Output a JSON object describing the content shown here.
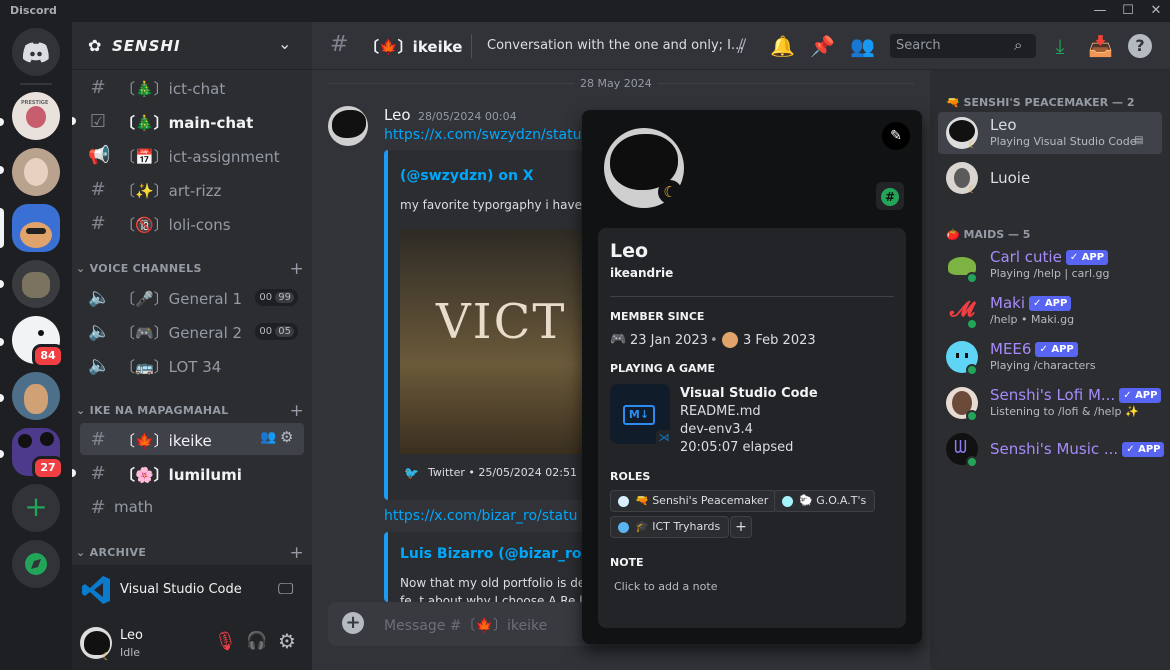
{
  "app": {
    "title": "Discord"
  },
  "server": {
    "name": "SENSHI"
  },
  "rail": {
    "badges": [
      "84",
      "27"
    ]
  },
  "channels": [
    {
      "name": "〔🎄〕ict-chat",
      "state": "normal"
    },
    {
      "name": "〔🎄〕main-chat",
      "state": "unread"
    },
    {
      "name": "〔📅〕ict-assignment",
      "state": "normal"
    },
    {
      "name": "〔✨〕art-rizz",
      "state": "normal"
    },
    {
      "name": "〔🔞〕loli-cons",
      "state": "normal"
    }
  ],
  "voice_category": "VOICE CHANNELS",
  "voice": [
    {
      "name": "〔🎤〕General 1",
      "a": "00",
      "b": "99"
    },
    {
      "name": "〔🎮〕General 2",
      "a": "00",
      "b": "05"
    },
    {
      "name": "〔🚌〕LOT 34"
    }
  ],
  "ike_category": "IKE NA MAPAGMAHAL",
  "ike_channels": [
    {
      "name": "〔🍁〕ikeike",
      "state": "active"
    },
    {
      "name": "〔🌸〕lumilumi",
      "state": "unread"
    },
    {
      "name": "math",
      "state": "normal"
    }
  ],
  "archive_category": "ARCHIVE",
  "activity": {
    "app": "Visual Studio Code"
  },
  "user": {
    "name": "Leo",
    "status": "Idle"
  },
  "chat": {
    "channel": "〔🍁〕ikeike",
    "topic": "Conversation with the one and only; I...",
    "date_divider": "28 May 2024",
    "search_placeholder": "Search",
    "composer_placeholder": "Message #〔🍁〕ikeike"
  },
  "message": {
    "author": "Leo",
    "timestamp": "28/05/2024 00:04",
    "link1": "https://x.com/swzydzn/statu",
    "embed1": {
      "author": "(@swzydzn) on X",
      "text": "my favorite typorgaphy i have c",
      "image_text": "VICT",
      "footer": "Twitter • 25/05/2024 02:51"
    },
    "link2": "https://x.com/bizar_ro/statu",
    "embed2": {
      "author": "Luis Bizarro (@bizar_ro) o",
      "text1": "Now that my old portfolio is de",
      "text2": "fe..t about why I choose A Re.l."
    }
  },
  "members": {
    "group1": "SENSHI'S PEACEMAKER — 2",
    "group2": "MAIDS — 5",
    "app_badge": "APP",
    "list1": [
      {
        "name": "Leo",
        "status": "Playing Visual Studio Code",
        "color": "#f2f3f5"
      },
      {
        "name": "Luoie",
        "status": "",
        "color": "#f2f3f5"
      }
    ],
    "list2": [
      {
        "name": "Carl cutie",
        "status": "Playing /help | carl.gg",
        "color": "#a78bfa"
      },
      {
        "name": "Maki",
        "status": "/help • Maki.gg",
        "color": "#a78bfa"
      },
      {
        "name": "MEE6",
        "status": "Playing /characters",
        "color": "#a78bfa"
      },
      {
        "name": "Senshi's Lofi M...",
        "status": "Listening to /lofi & /help ✨",
        "color": "#a78bfa"
      },
      {
        "name": "Senshi's Music ...",
        "status": "",
        "color": "#a78bfa"
      }
    ]
  },
  "profile": {
    "display_name": "Leo",
    "username": "ikeandrie",
    "member_since_label": "MEMBER SINCE",
    "discord_date": "23 Jan 2023",
    "server_date": "3 Feb 2023",
    "playing_label": "PLAYING A GAME",
    "game": "Visual Studio Code",
    "game_details": [
      "README.md",
      "dev-env3.4",
      "20:05:07 elapsed"
    ],
    "roles_label": "ROLES",
    "roles": [
      {
        "name": "Senshi's Peacemaker",
        "color": "#d9f1ff"
      },
      {
        "name": "G.O.A.T's",
        "color": "#a5f3fc"
      },
      {
        "name": "ICT Tryhards",
        "color": "#5ab4f0"
      }
    ],
    "note_label": "NOTE",
    "note_placeholder": "Click to add a note"
  }
}
